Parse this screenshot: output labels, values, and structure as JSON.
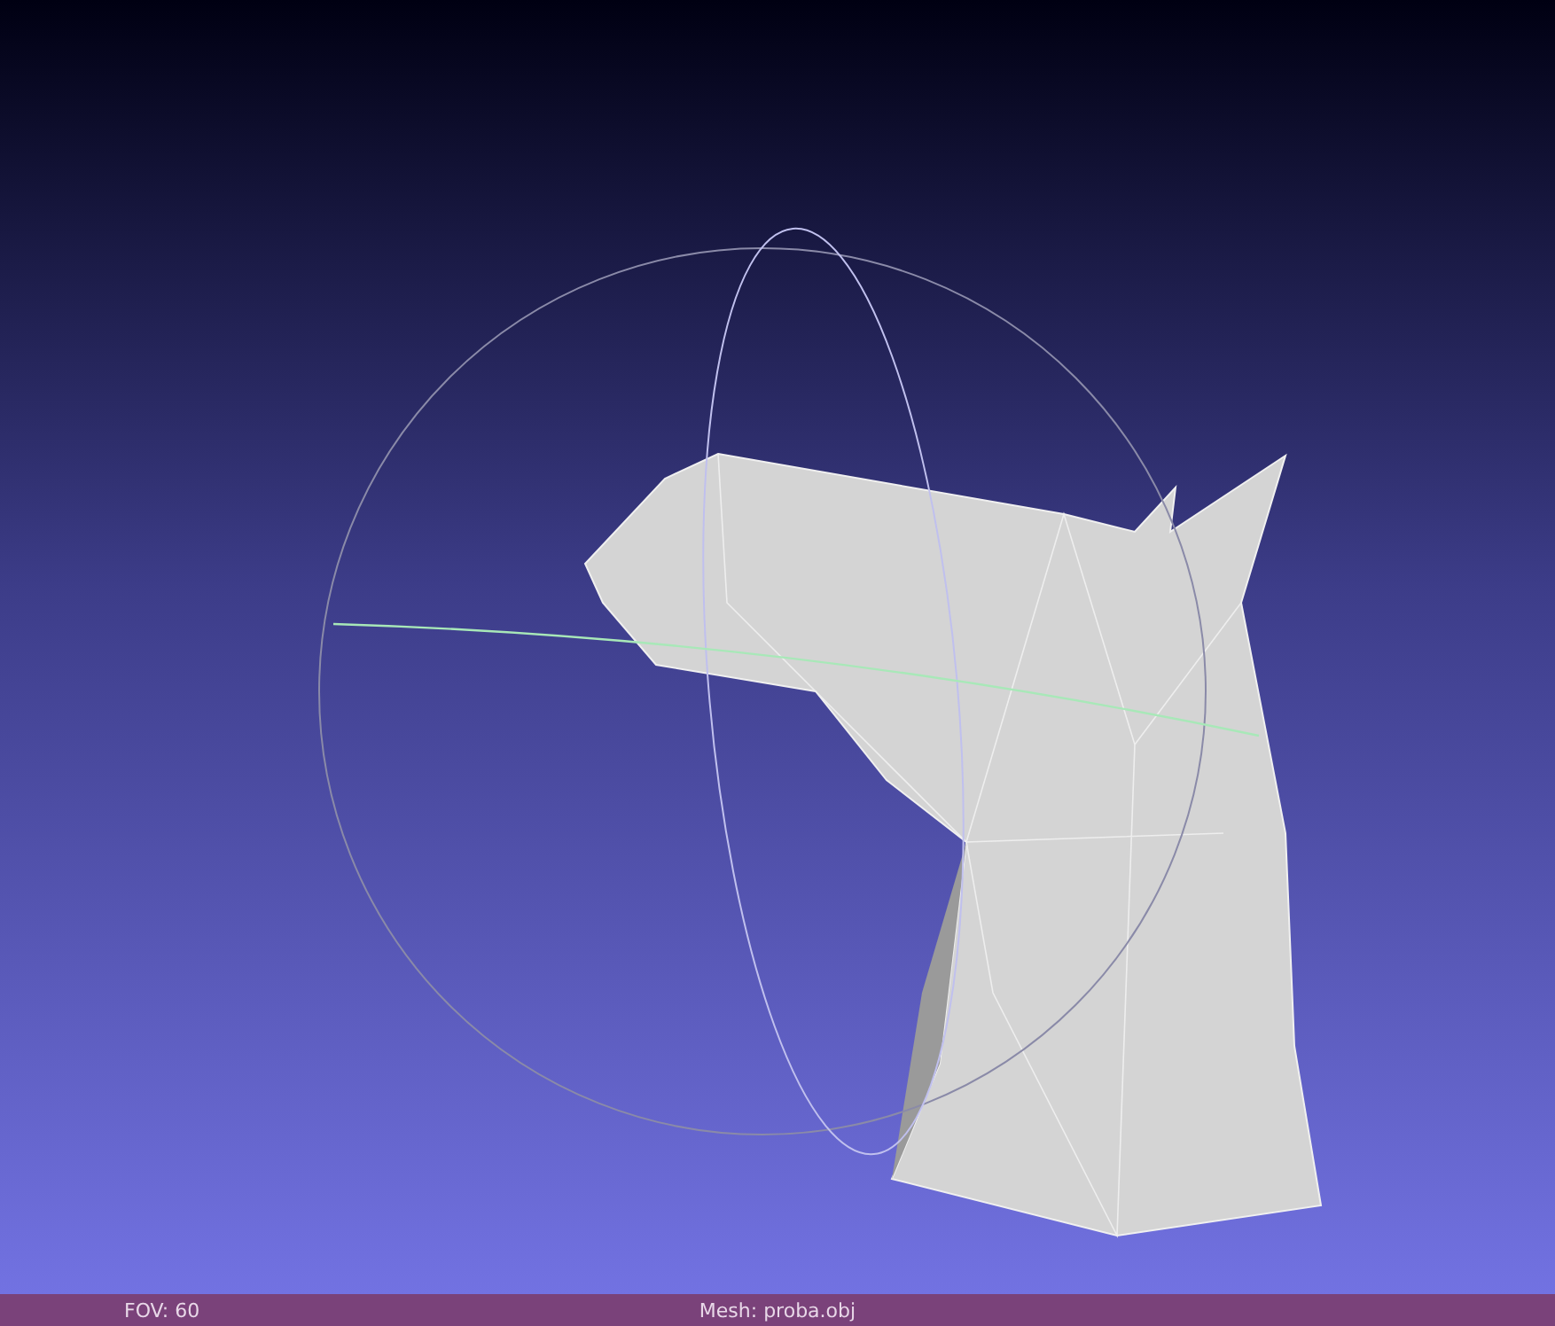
{
  "status_bar": {
    "left": "FOV: 60",
    "center": "Mesh: proba.obj"
  }
}
